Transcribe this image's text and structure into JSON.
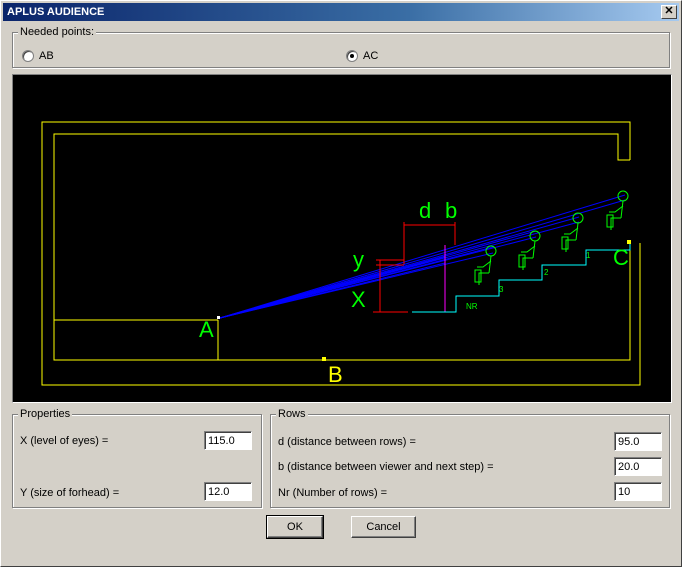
{
  "window": {
    "title": "APLUS AUDIENCE",
    "close_glyph": "✕"
  },
  "needed_points": {
    "label": "Needed points:",
    "options": [
      {
        "label": "AB",
        "selected": false
      },
      {
        "label": "AC",
        "selected": true
      }
    ]
  },
  "diagram": {
    "point_labels": {
      "a": "A",
      "b": "B",
      "c": "C"
    },
    "dim_labels": {
      "d": "d",
      "b": "b",
      "y": "y",
      "x": "X"
    },
    "row_labels": {
      "nr": "NR",
      "r1": "1",
      "r2": "2",
      "r3": "3"
    },
    "colors": {
      "room": "#ffff00",
      "text": "#00ff00",
      "sight": "#0000ff",
      "dim": "#ff0000",
      "step": "#00ffff",
      "marker": "#ff00ff"
    }
  },
  "properties": {
    "label": "Properties",
    "x_label": "X (level of eyes) =",
    "x_value": "115.0",
    "y_label": "Y (size of forhead) =",
    "y_value": "12.0"
  },
  "rows": {
    "label": "Rows",
    "d_label": "d (distance between rows) =",
    "d_value": "95.0",
    "b_label": "b (distance between viewer and next step) =",
    "b_value": "20.0",
    "nr_label": "Nr (Number of rows) =",
    "nr_value": "10"
  },
  "buttons": {
    "ok": "OK",
    "cancel": "Cancel"
  }
}
